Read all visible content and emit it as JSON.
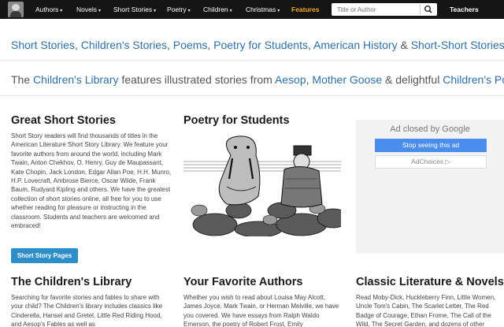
{
  "nav": {
    "items": [
      {
        "label": "Authors",
        "caret": "▾"
      },
      {
        "label": "Novels",
        "caret": "▾"
      },
      {
        "label": "Short Stories",
        "caret": "▾"
      },
      {
        "label": "Poetry",
        "caret": "▾"
      },
      {
        "label": "Children",
        "caret": "▾"
      },
      {
        "label": "Christmas",
        "caret": "▾"
      },
      {
        "label": "Features",
        "caret": ""
      },
      {
        "label": "Teachers",
        "caret": ""
      }
    ],
    "search_placeholder": "Title or Author",
    "search_icon": "search-icon",
    "accent_color": "#f5a623"
  },
  "links_line": {
    "items": [
      "Short Stories",
      "Children's Stories",
      "Poems",
      "Poetry for Students",
      "American History",
      "Short-Short Stories"
    ],
    "separators": [
      ", ",
      ", ",
      ", ",
      ", ",
      " & "
    ]
  },
  "library_line": {
    "prefix": "The ",
    "link1": "Children's Library",
    "mid1": " features illustrated stories from ",
    "link2": "Aesop",
    "mid2": ", ",
    "link3": "Mother Goose",
    "mid3": " & delightful ",
    "link4": "Children's Poems"
  },
  "short_stories": {
    "title": "Great Short Stories",
    "body": "Short Story readers will find thousands of titles in the American Literature Short Story Library. We feature your favorite authors from around the world, including Mark Twain, Anton Chekhov, O. Henry, Guy de Maupassant, Kate Chopin, Jack London, Edgar Allan Poe, H.H. Munro, H.P. Lovecraft, Ambrose Bierce, Oscar Wilde, Frank Baum, Rudyard Kipling and others. We have the greatest collection of short stories online, all free for you to use whether reading for pleasure or instructing in the classroom. Students and teachers are welcomed and embraced!",
    "button": "Short Story Pages"
  },
  "poetry": {
    "title": "Poetry for Students"
  },
  "ad": {
    "closed_by": "Ad closed by ",
    "brand": "Google",
    "stop": "Stop seeing this ad",
    "choices": "AdChoices ▷"
  },
  "childrens_library": {
    "title": "The Children's Library",
    "body": "Searching for favorite stories and fables to share with your child? The Children's library includes classics like Cinderella, Hansel and Gretel, Little Red Riding Hood, and Aesop's Fables as well as"
  },
  "favorite_authors": {
    "title": "Your Favorite Authors",
    "body": "Whether you wish to read about Louisa May Alcott, James Joyce, Mark Twain, or Herman Melville, we have you covered. We have essays from Ralph Waldo Emerson, the poetry of Robert Frost, Emily"
  },
  "classic_lit": {
    "title": "Classic Literature & Novels",
    "body": "Read Moby-Dick, Huckleberry Finn, Little Women, Uncle Tom's Cabin, The Scarlet Letter, The Red Badge of Courage, Ethan Frome, The Call of the Wild, The Secret Garden, and dozens of other"
  }
}
